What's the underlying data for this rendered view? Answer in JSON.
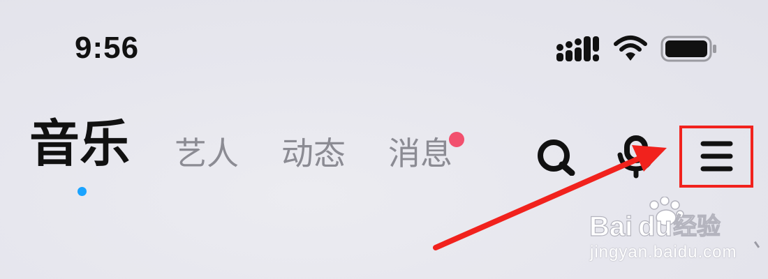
{
  "status_bar": {
    "time": "9:56",
    "icons": [
      "cellular-signal-icon",
      "wifi-icon",
      "battery-icon"
    ]
  },
  "nav": {
    "tabs": [
      {
        "label": "音乐",
        "active": true
      },
      {
        "label": "艺人",
        "active": false
      },
      {
        "label": "动态",
        "active": false
      },
      {
        "label": "消息",
        "active": false,
        "unread_dot": true
      }
    ],
    "actions": [
      "search-icon",
      "voice-mic-icon",
      "hamburger-menu-icon"
    ]
  },
  "annotation": {
    "highlight_target": "hamburger-menu-icon",
    "highlight_color": "#f1221d",
    "arrow_color": "#f1221d"
  },
  "watermark": {
    "logo_text": "Baidu经验",
    "url": "jingyan.baidu.com"
  },
  "colors": {
    "active_indicator": "#1aa3ff",
    "unread_dot": "#f2506e",
    "inactive_tab_text": "#8b8b93",
    "active_tab_text": "#111111"
  }
}
